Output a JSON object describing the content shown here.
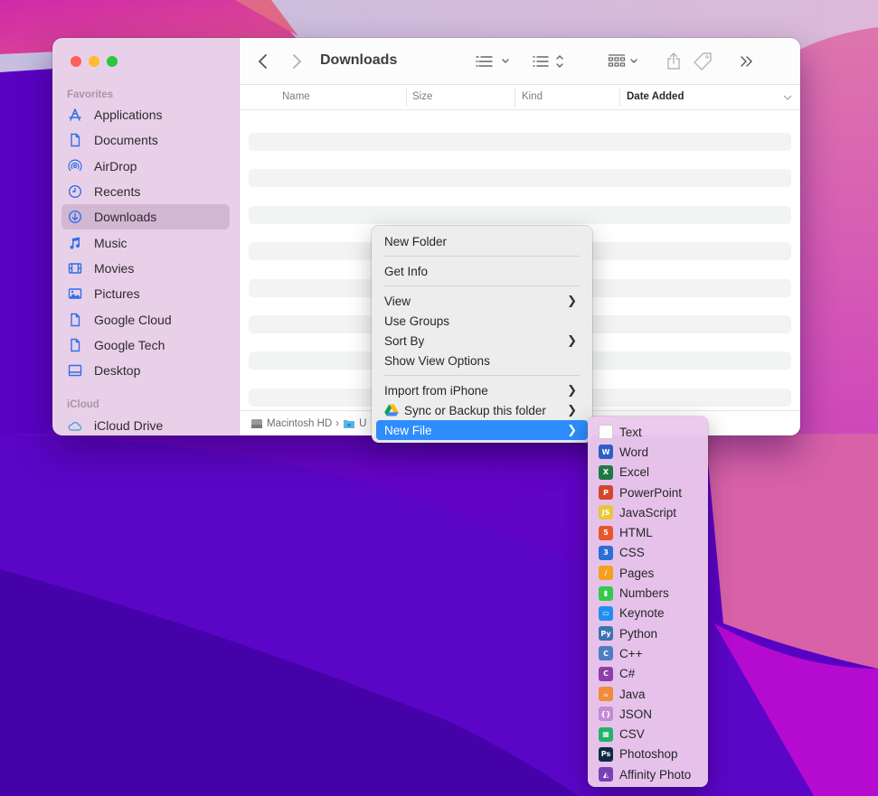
{
  "window": {
    "title": "Downloads",
    "traffic_lights": [
      "close",
      "minimize",
      "zoom"
    ]
  },
  "sidebar": {
    "favorites_label": "Favorites",
    "items": [
      {
        "label": "Applications",
        "icon": "applications-icon"
      },
      {
        "label": "Documents",
        "icon": "document-icon"
      },
      {
        "label": "AirDrop",
        "icon": "airdrop-icon"
      },
      {
        "label": "Recents",
        "icon": "clock-icon"
      },
      {
        "label": "Downloads",
        "icon": "download-icon",
        "active": true
      },
      {
        "label": "Music",
        "icon": "music-note-icon"
      },
      {
        "label": "Movies",
        "icon": "film-icon"
      },
      {
        "label": "Pictures",
        "icon": "photo-icon"
      },
      {
        "label": "Google Cloud",
        "icon": "document-icon"
      },
      {
        "label": "Google Tech",
        "icon": "document-icon"
      },
      {
        "label": "Desktop",
        "icon": "desktop-icon"
      }
    ],
    "icloud_label": "iCloud",
    "icloud_items": [
      {
        "label": "iCloud Drive",
        "icon": "cloud-icon"
      }
    ]
  },
  "toolbar": {
    "back": "chevron-left-icon",
    "forward": "chevron-right-icon",
    "view_options": "list-view-icon",
    "group": "group-icon",
    "gallery": "grid-icon",
    "share": "share-icon",
    "tag": "tag-icon",
    "more": "double-chevron-icon",
    "search": "search-icon"
  },
  "columns": [
    {
      "label": "Name"
    },
    {
      "label": "Size"
    },
    {
      "label": "Kind"
    },
    {
      "label": "Date Added",
      "sorted": true
    }
  ],
  "pathbar": {
    "items": [
      "Macintosh HD",
      "U"
    ]
  },
  "context_menu": {
    "groups": [
      [
        {
          "label": "New Folder"
        }
      ],
      [
        {
          "label": "Get Info"
        }
      ],
      [
        {
          "label": "View",
          "submenu": true
        },
        {
          "label": "Use Groups"
        },
        {
          "label": "Sort By",
          "submenu": true
        },
        {
          "label": "Show View Options"
        }
      ],
      [
        {
          "label": "Import from iPhone",
          "submenu": true
        },
        {
          "label": "Sync or Backup this folder",
          "submenu": true,
          "icon": "google-drive-icon"
        },
        {
          "label": "New File",
          "submenu": true,
          "highlighted": true
        }
      ]
    ],
    "highlight_color": "#2e8dfc"
  },
  "new_file_submenu": {
    "items": [
      {
        "label": "Text",
        "icon": "text-file-icon",
        "color": "#ffffff",
        "glyph": ""
      },
      {
        "label": "Word",
        "icon": "word-icon",
        "color": "#2b5ec7",
        "glyph": "W"
      },
      {
        "label": "Excel",
        "icon": "excel-icon",
        "color": "#1e7a45",
        "glyph": "X"
      },
      {
        "label": "PowerPoint",
        "icon": "powerpoint-icon",
        "color": "#d0482a",
        "glyph": "P"
      },
      {
        "label": "JavaScript",
        "icon": "javascript-icon",
        "color": "#e8c53a",
        "glyph": "JS"
      },
      {
        "label": "HTML",
        "icon": "html5-icon",
        "color": "#e8572c",
        "glyph": "5"
      },
      {
        "label": "CSS",
        "icon": "css3-icon",
        "color": "#2b6fd6",
        "glyph": "3"
      },
      {
        "label": "Pages",
        "icon": "pages-icon",
        "color": "#f59f1b",
        "glyph": "/"
      },
      {
        "label": "Numbers",
        "icon": "numbers-icon",
        "color": "#33c94b",
        "glyph": "▮"
      },
      {
        "label": "Keynote",
        "icon": "keynote-icon",
        "color": "#1f8ef1",
        "glyph": "▭"
      },
      {
        "label": "Python",
        "icon": "python-icon",
        "color": "#3d74b0",
        "glyph": "Py"
      },
      {
        "label": "C++",
        "icon": "cpp-icon",
        "color": "#4d7ec4",
        "glyph": "C"
      },
      {
        "label": "C#",
        "icon": "csharp-icon",
        "color": "#8c3fa8",
        "glyph": "C"
      },
      {
        "label": "Java",
        "icon": "java-icon",
        "color": "#f28a3a",
        "glyph": "☕"
      },
      {
        "label": "JSON",
        "icon": "json-icon",
        "color": "#c58ad8",
        "glyph": "{}"
      },
      {
        "label": "CSV",
        "icon": "csv-icon",
        "color": "#22b26a",
        "glyph": "▦"
      },
      {
        "label": "Photoshop",
        "icon": "photoshop-icon",
        "color": "#0f2a45",
        "glyph": "Ps"
      },
      {
        "label": "Affinity Photo",
        "icon": "affinity-photo-icon",
        "color": "#7a3fb5",
        "glyph": "◭"
      }
    ]
  }
}
